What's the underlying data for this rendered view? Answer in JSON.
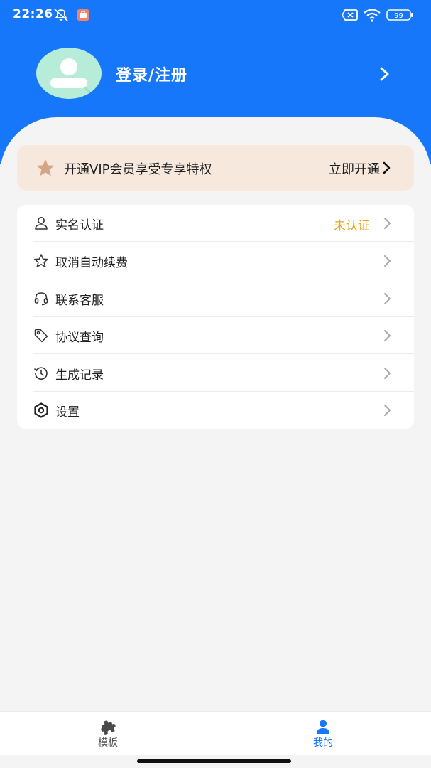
{
  "status_bar": {
    "time": "22:26",
    "battery": "99",
    "icons": [
      "no-disturb-icon",
      "app-notification-icon",
      "sim-error-icon",
      "wifi-icon",
      "battery-icon"
    ]
  },
  "profile": {
    "login_label": "登录/注册",
    "avatar_icon": "user-avatar-icon"
  },
  "vip": {
    "text": "开通VIP会员享受专享特权",
    "action": "立即开通",
    "star_color": "#d6a586",
    "background": "#f7e8dd"
  },
  "menu": {
    "items": [
      {
        "label": "实名认证",
        "icon": "person-icon",
        "status": "未认证"
      },
      {
        "label": "取消自动续费",
        "icon": "star-outline-icon"
      },
      {
        "label": "联系客服",
        "icon": "headset-icon"
      },
      {
        "label": "协议查询",
        "icon": "tag-icon"
      },
      {
        "label": "生成记录",
        "icon": "history-icon"
      },
      {
        "label": "设置",
        "icon": "settings-hex-icon"
      }
    ]
  },
  "bottom_nav": {
    "items": [
      {
        "label": "模板",
        "icon": "puzzle-icon",
        "active": false
      },
      {
        "label": "我的",
        "icon": "person-filled-icon",
        "active": true
      }
    ]
  },
  "colors": {
    "primary": "#1677fb",
    "status_pending": "#eea31a",
    "nav_active": "#1677fb",
    "nav_inactive": "#555555"
  }
}
